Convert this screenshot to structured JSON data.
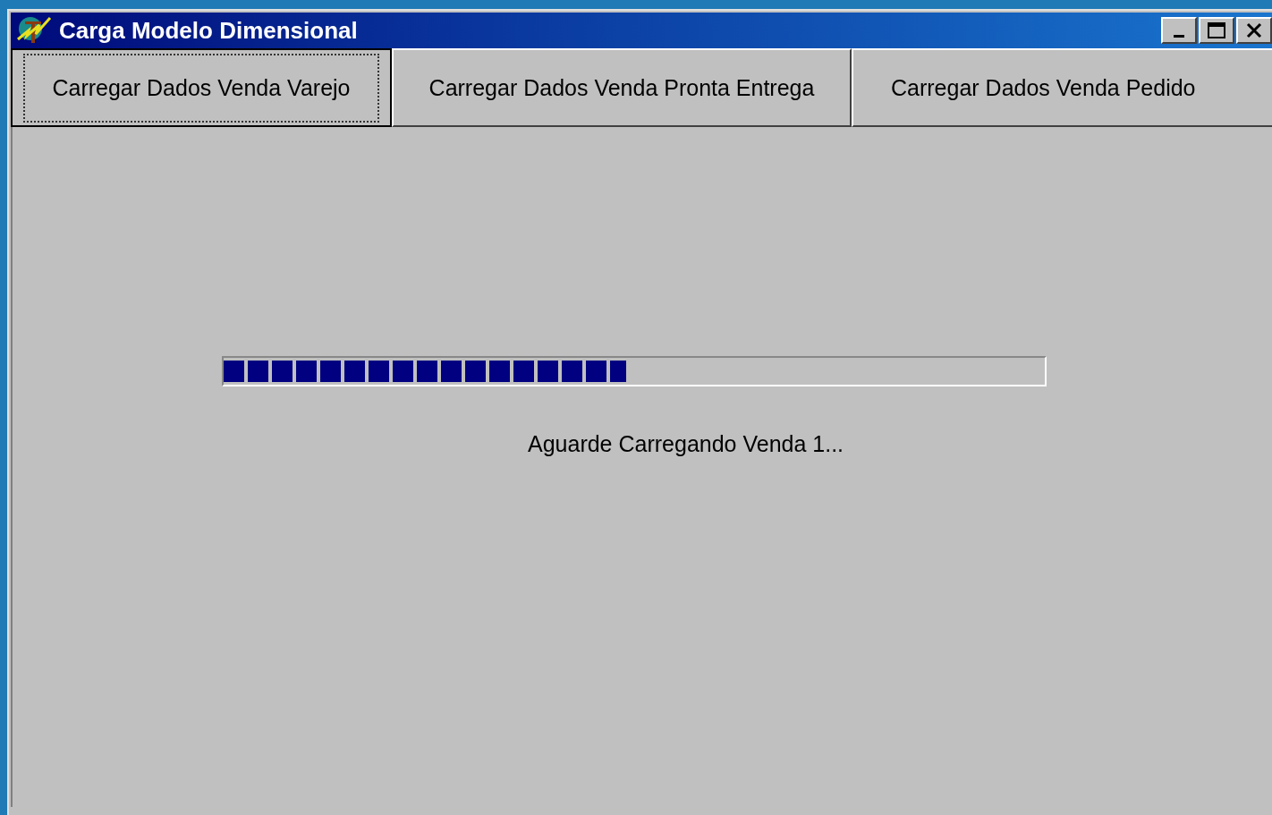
{
  "window": {
    "title": "Carga Modelo Dimensional"
  },
  "buttons": [
    {
      "label": "Carregar Dados Venda Varejo",
      "focused": true
    },
    {
      "label": "Carregar Dados Venda Pronta Entrega",
      "focused": false
    },
    {
      "label": "Carregar Dados Venda Pedido",
      "focused": false
    }
  ],
  "progress": {
    "level": 0.49
  },
  "status": "Aguarde Carregando Venda 1..."
}
